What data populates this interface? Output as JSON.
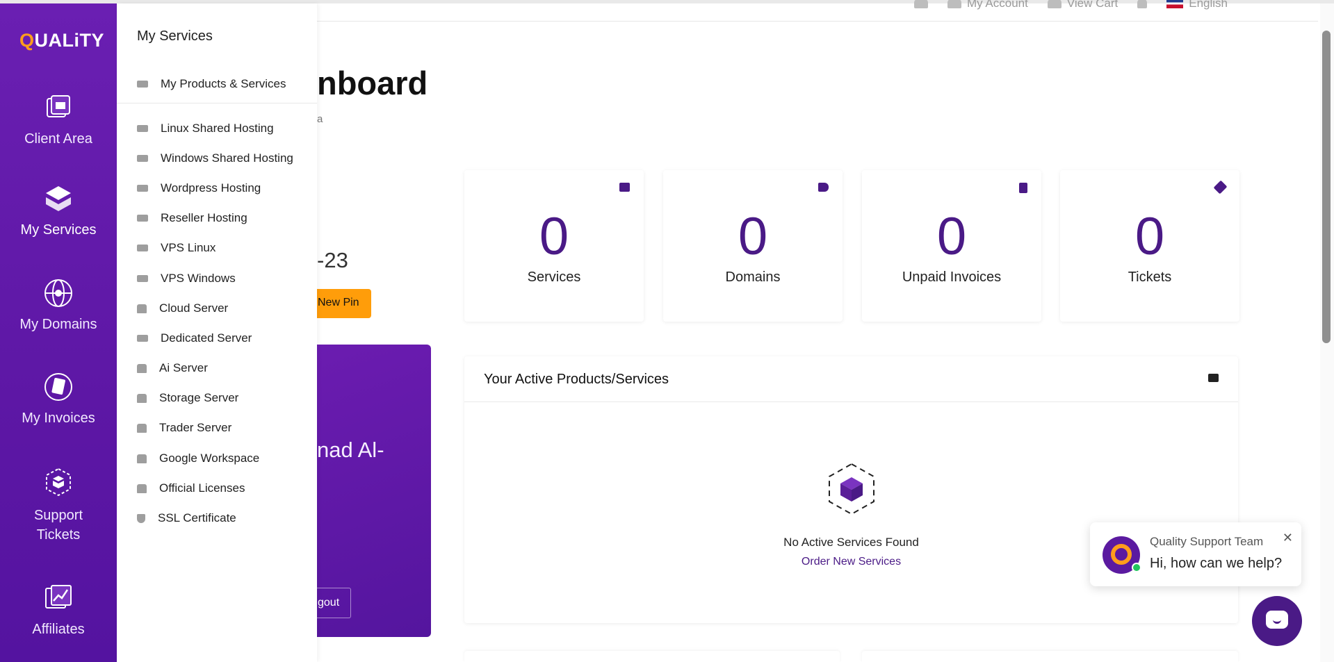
{
  "topbar": {
    "my_account": "My Account",
    "view_cart": "View Cart",
    "language": "English"
  },
  "brand": {
    "logo_q": "Q",
    "logo_rest": "UALiTY"
  },
  "sidebar": {
    "items": [
      {
        "label": "Client Area",
        "icon": "client-area-icon"
      },
      {
        "label": "My Services",
        "icon": "services-icon"
      },
      {
        "label": "My Domains",
        "icon": "globe-icon"
      },
      {
        "label": "My Invoices",
        "icon": "invoice-icon"
      },
      {
        "label": "Support Tickets",
        "icon": "ticket-icon"
      },
      {
        "label": "Affiliates",
        "icon": "chart-icon"
      }
    ]
  },
  "dropdown": {
    "title": "My Services",
    "items": [
      "My Products & Services",
      "Linux Shared Hosting",
      "Windows Shared Hosting",
      "Wordpress Hosting",
      "Reseller Hosting",
      "VPS Linux",
      "VPS Windows",
      "Cloud Server",
      "Dedicated Server",
      "Ai Server",
      "Storage Server",
      "Trader Server",
      "Google Workspace",
      "Official Licenses",
      "SSL Certificate"
    ]
  },
  "dashboard": {
    "title_partial": "nboard",
    "subtitle_partial": "a",
    "pin_partial": "-23",
    "new_pin_partial": "New Pin",
    "profile_name_partial": "nad Al-",
    "logout_partial": "gout"
  },
  "stats": [
    {
      "value": "0",
      "label": "Services"
    },
    {
      "value": "0",
      "label": "Domains"
    },
    {
      "value": "0",
      "label": "Unpaid Invoices"
    },
    {
      "value": "0",
      "label": "Tickets"
    }
  ],
  "active_panel": {
    "title": "Your Active Products/Services",
    "empty_text": "No Active Services Found",
    "order_link": "Order New Services"
  },
  "chat": {
    "team": "Quality Support Team",
    "message": "Hi, how can we help?",
    "close": "✕"
  },
  "colors": {
    "sidebar": "#6a1fb2",
    "accent": "#ff9d1c",
    "primary": "#4a1a86"
  }
}
